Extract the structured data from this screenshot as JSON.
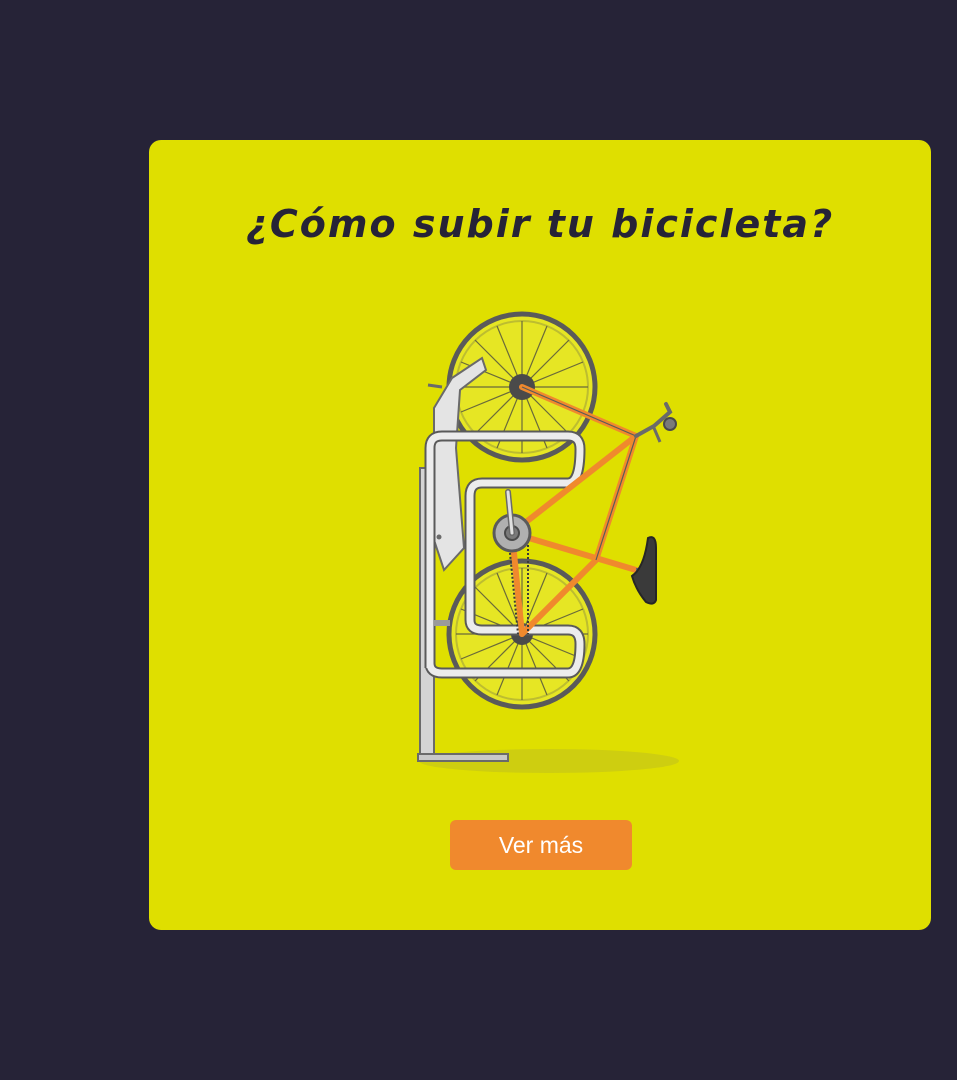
{
  "card": {
    "title": "¿Cómo subir tu bicicleta?",
    "illustration_icon": "bike-on-vertical-rack",
    "cta_label": "Ver más"
  },
  "colors": {
    "page_background": "#262337",
    "card_background": "#dfdf00",
    "button_background": "#f0892d",
    "bike_frame": "#f0892d",
    "rack": "#d9d9d9"
  }
}
